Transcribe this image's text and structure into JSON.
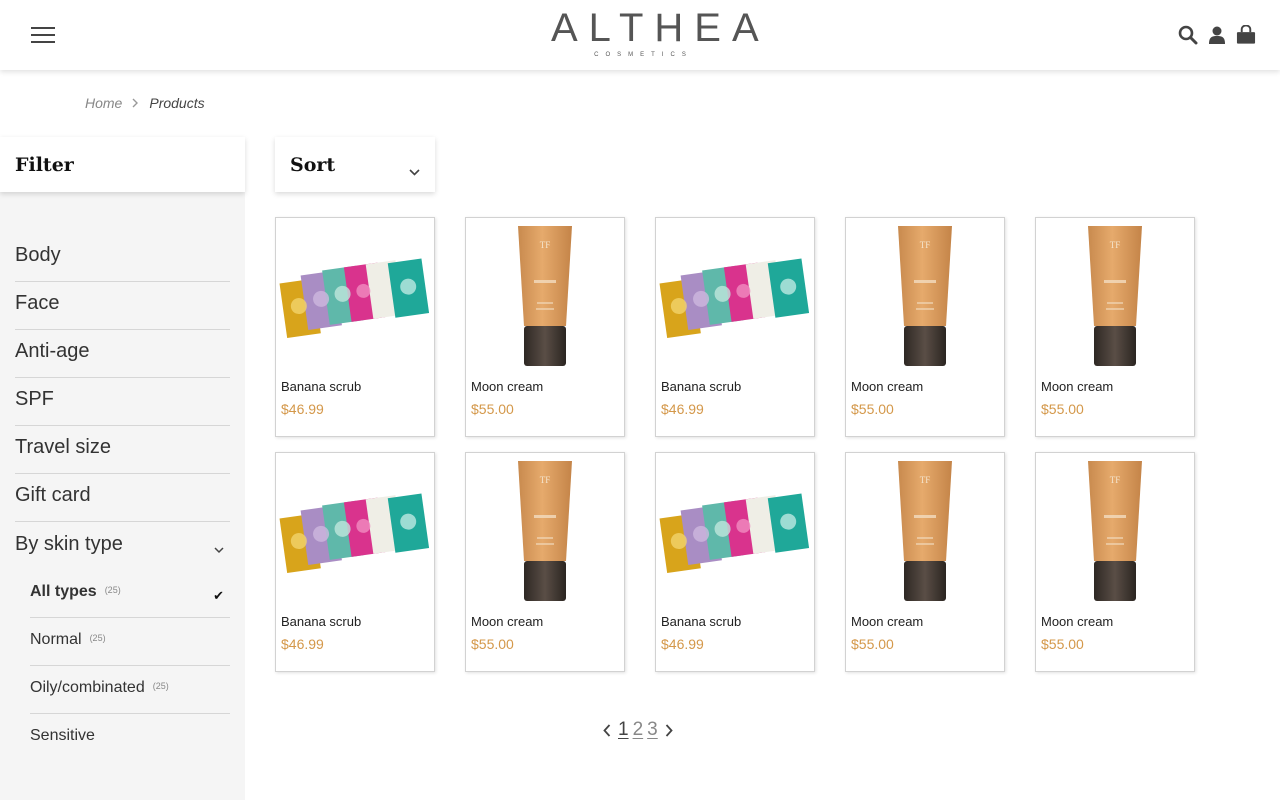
{
  "header": {
    "logo_main": "ALTHEA",
    "logo_sub": "COSMETICS",
    "menu_icon": "hamburger-menu-icon",
    "icons": [
      "search-icon",
      "user-icon",
      "shopping-bag-icon"
    ]
  },
  "breadcrumb": {
    "home": "Home",
    "current": "Products"
  },
  "filter": {
    "title": "Filter",
    "categories": [
      {
        "label": "Body"
      },
      {
        "label": "Face"
      },
      {
        "label": "Anti-age"
      },
      {
        "label": "SPF"
      },
      {
        "label": "Travel size"
      },
      {
        "label": "Gift card"
      }
    ],
    "skin_type": {
      "label": "By skin type",
      "options": [
        {
          "label": "All types",
          "count": "(25)",
          "selected": true
        },
        {
          "label": "Normal",
          "count": "(25)",
          "selected": false
        },
        {
          "label": "Oily/combinated",
          "count": "(25)",
          "selected": false
        },
        {
          "label": "Sensitive",
          "count": "",
          "selected": false
        }
      ]
    }
  },
  "sort": {
    "label": "Sort"
  },
  "products": [
    {
      "name": "Banana scrub",
      "price": "$46.99",
      "image": "sachets"
    },
    {
      "name": "Moon cream",
      "price": "$55.00",
      "image": "tube"
    },
    {
      "name": "Banana scrub",
      "price": "$46.99",
      "image": "sachets"
    },
    {
      "name": "Moon cream",
      "price": "$55.00",
      "image": "tube"
    },
    {
      "name": "Moon cream",
      "price": "$55.00",
      "image": "tube"
    },
    {
      "name": "Banana scrub",
      "price": "$46.99",
      "image": "sachets"
    },
    {
      "name": "Moon cream",
      "price": "$55.00",
      "image": "tube"
    },
    {
      "name": "Banana scrub",
      "price": "$46.99",
      "image": "sachets"
    },
    {
      "name": "Moon cream",
      "price": "$55.00",
      "image": "tube"
    },
    {
      "name": "Moon cream",
      "price": "$55.00",
      "image": "tube"
    }
  ],
  "pagination": {
    "pages": [
      "1",
      "2",
      "3"
    ],
    "current": "1"
  },
  "colors": {
    "price": "#d4984a",
    "sidebar_bg": "#f5f5f5"
  }
}
